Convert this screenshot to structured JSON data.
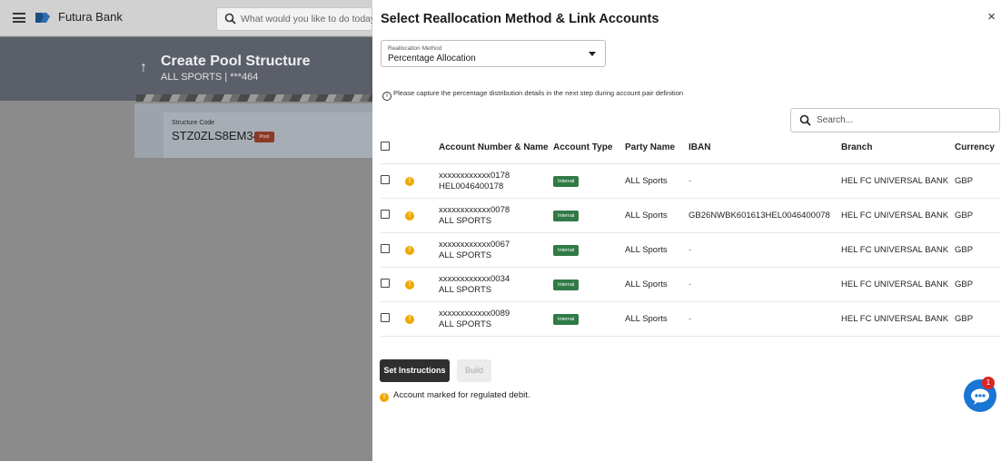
{
  "app": {
    "brand": "Futura Bank",
    "search_placeholder": "What would you like to do today?",
    "page_title": "Create Pool Structure",
    "page_subtitle": "ALL SPORTS | ***464",
    "structure_code_label": "Structure Code",
    "structure_code": "STZ0ZLS8EM34",
    "pool_badge": "Pool"
  },
  "modal": {
    "title": "Select Reallocation Method & Link Accounts",
    "close": "×",
    "reallocation_label": "Reallocation Method",
    "reallocation_value": "Percentage Allocation",
    "info_note": "Please capture the percentage distribution details in the next step during account pair definition",
    "table_search_placeholder": "Search...",
    "columns": [
      "Account Number & Name",
      "Account Type",
      "Party Name",
      "IBAN",
      "Branch",
      "Currency"
    ],
    "rows": [
      {
        "number": "xxxxxxxxxxxx0178",
        "name": "HEL0046400178",
        "type": "Internal",
        "party": "ALL Sports",
        "iban": "-",
        "branch": "HEL FC UNIVERSAL BANK",
        "currency": "GBP"
      },
      {
        "number": "xxxxxxxxxxxx0078",
        "name": "ALL SPORTS",
        "type": "Internal",
        "party": "ALL Sports",
        "iban": "GB26NWBK601613HEL0046400078",
        "branch": "HEL FC UNIVERSAL BANK",
        "currency": "GBP"
      },
      {
        "number": "xxxxxxxxxxxx0067",
        "name": "ALL SPORTS",
        "type": "Internal",
        "party": "ALL Sports",
        "iban": "-",
        "branch": "HEL FC UNIVERSAL BANK",
        "currency": "GBP"
      },
      {
        "number": "xxxxxxxxxxxx0034",
        "name": "ALL SPORTS",
        "type": "Internal",
        "party": "ALL Sports",
        "iban": "-",
        "branch": "HEL FC UNIVERSAL BANK",
        "currency": "GBP"
      },
      {
        "number": "xxxxxxxxxxxx0089",
        "name": "ALL SPORTS",
        "type": "Internal",
        "party": "ALL Sports",
        "iban": "-",
        "branch": "HEL FC UNIVERSAL BANK",
        "currency": "GBP"
      }
    ],
    "set_instructions_label": "Set Instructions",
    "build_label": "Build",
    "legend_text": "Account marked for regulated debit."
  },
  "chat": {
    "badge_count": "1"
  },
  "colors": {
    "internal_badge": "#2f7a46",
    "warning": "#f0a800",
    "chat": "#1976d2",
    "primary_button": "#2f2f2f"
  }
}
